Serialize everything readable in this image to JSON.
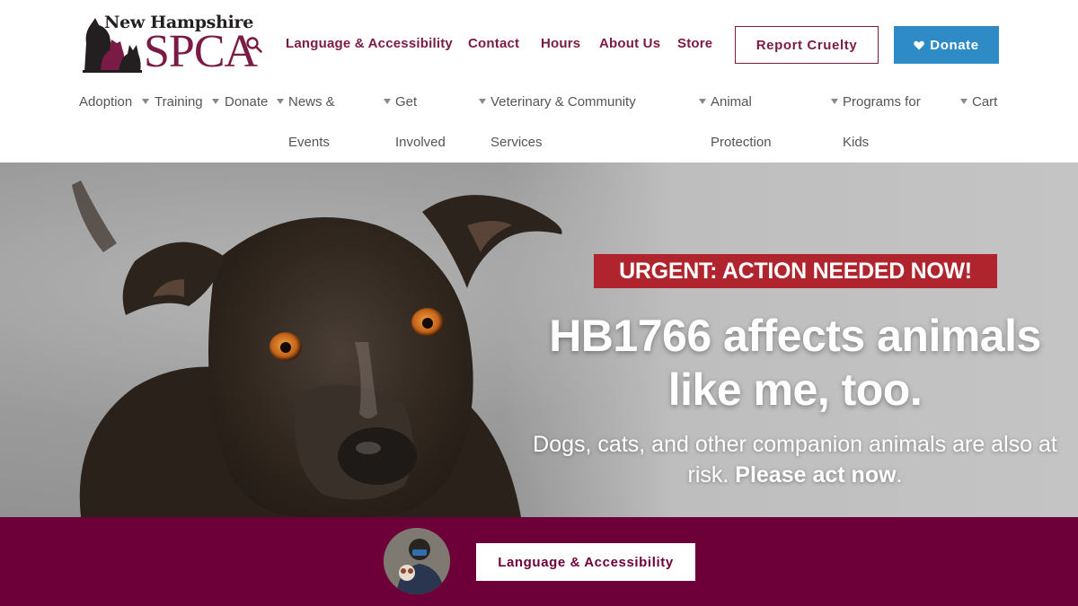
{
  "logo": {
    "line1": "New Hampshire",
    "line2": "SPCA"
  },
  "utility_nav": [
    {
      "label": "Language & Accessibility"
    },
    {
      "label": "Contact"
    },
    {
      "label": "Hours"
    },
    {
      "label": "About Us"
    },
    {
      "label": "Store"
    }
  ],
  "buttons": {
    "report_cruelty": "Report Cruelty",
    "donate": "Donate"
  },
  "main_nav": [
    {
      "label": "Adoption"
    },
    {
      "label": "Training"
    },
    {
      "label": "Donate"
    },
    {
      "label": "News & Events"
    },
    {
      "label": "Get Involved"
    },
    {
      "label": "Veterinary & Community Services"
    },
    {
      "label": "Animal Protection"
    },
    {
      "label": "Programs for Kids"
    },
    {
      "label": "Cart"
    }
  ],
  "hero": {
    "urgent": "URGENT: ACTION NEEDED NOW!",
    "headline": "HB1766 affects animals like me, too.",
    "sub_text": "Dogs, cats, and other companion animals are also at risk.",
    "sub_emphasis": "Please act now",
    "sub_end": "."
  },
  "footer_band": {
    "button": "Language & Accessibility"
  },
  "colors": {
    "brand_maroon": "#7a1b46",
    "band": "#6e0039",
    "donate_blue": "#2f8bc5",
    "urgent_red": "#b0242d"
  },
  "icons": [
    "search-icon",
    "heart-icon",
    "caret-down-icon"
  ]
}
